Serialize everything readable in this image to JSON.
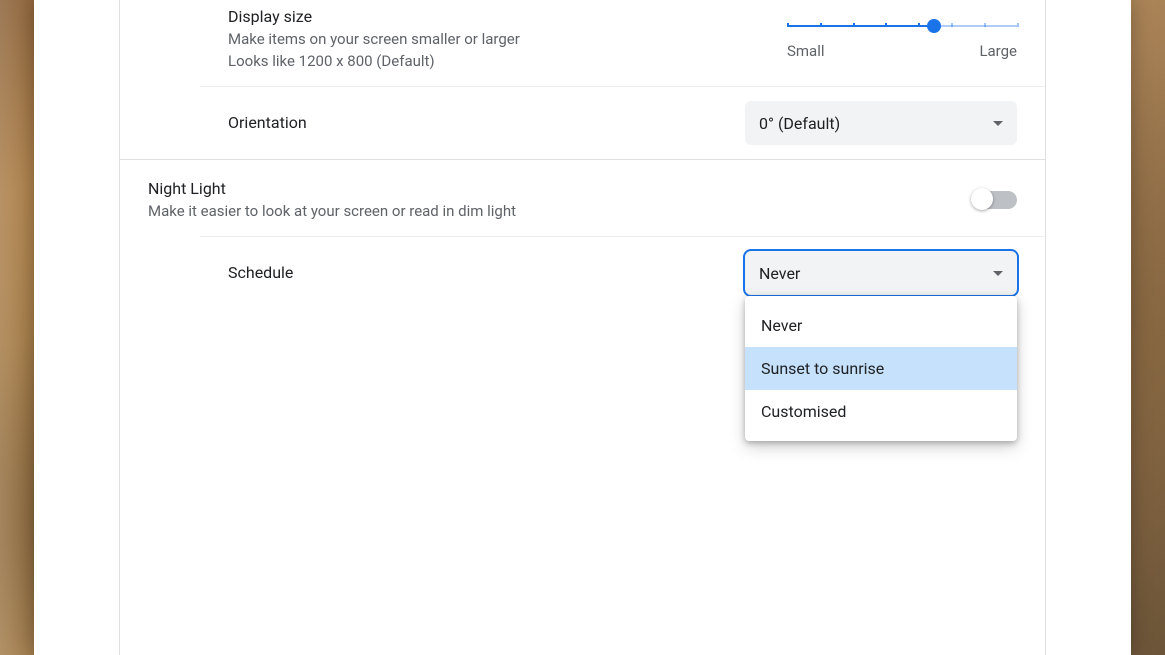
{
  "display": {
    "size_title": "Display size",
    "size_desc": "Make items on your screen smaller or larger",
    "size_resolution": "Looks like 1200 x 800 (Default)",
    "slider_small": "Small",
    "slider_large": "Large",
    "orientation_label": "Orientation",
    "orientation_value": "0° (Default)"
  },
  "nightlight": {
    "title": "Night Light",
    "desc": "Make it easier to look at your screen or read in dim light",
    "toggle_on": false,
    "schedule_label": "Schedule",
    "schedule_value": "Never",
    "options": [
      "Never",
      "Sunset to sunrise",
      "Customised"
    ],
    "highlighted_index": 1
  }
}
